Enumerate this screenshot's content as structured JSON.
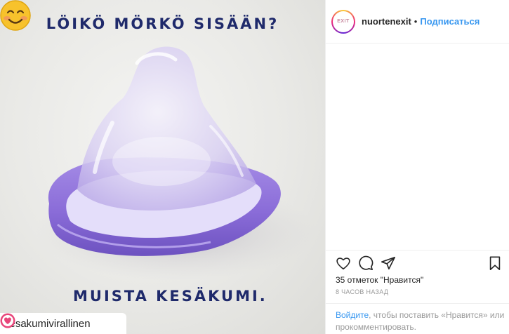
{
  "image": {
    "headline": "LÖIKÖ MÖRKÖ SISÄÄN?",
    "tagline": "MUISTA KESÄKUMI.",
    "emoji_icon": "smiling-face-emoji",
    "repost_username": "kesakumivirallinen",
    "repost_icon": "pink-heart-badge-icon"
  },
  "header": {
    "avatar_text": "EXIT",
    "username": "nuortenexit",
    "separator": "•",
    "follow_label": "Подписаться"
  },
  "actions": {
    "like_icon": "heart-icon",
    "comment_icon": "comment-icon",
    "share_icon": "share-icon",
    "save_icon": "bookmark-icon"
  },
  "likes_text": "35 отметок \"Нравится\"",
  "time_ago": "8 часов назад",
  "login_prompt": {
    "link": "Войдите",
    "text": ", чтобы поставить «Нравится» или прокомментировать."
  },
  "colors": {
    "headline_text": "#1f2a6b",
    "condom_rim": "#8c6fd8",
    "link_blue": "#3897f0"
  }
}
